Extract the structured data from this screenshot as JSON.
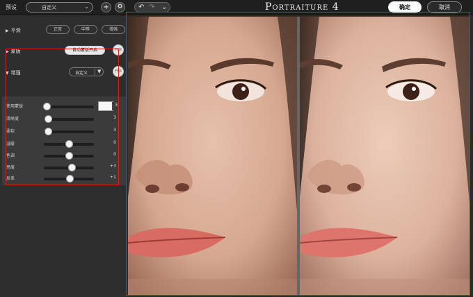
{
  "toolbar": {
    "preset_label": "预设",
    "preset_value": "自定义",
    "preset_chevron": "⌄",
    "add_icon": "+",
    "gear_icon": "⚙",
    "undo_icon": "↶",
    "redo_icon": "↷",
    "history_chevron": "⌄",
    "app_title": "Portraiture 4",
    "ok_label": "确定",
    "cancel_label": "取消"
  },
  "panel": {
    "smooth": {
      "label": "平滑",
      "options": [
        "正常",
        "中等",
        "增强"
      ]
    },
    "mask": {
      "label": "蒙版",
      "auto_button": "自动蒙版开启",
      "toggle": "开启"
    },
    "enhance": {
      "label": "增强",
      "dropdown_value": "自定义",
      "dropdown_arrow": "▼",
      "toggle": "开启",
      "sliders": [
        {
          "label": "使用蒙版",
          "value": "3",
          "level": 0.05
        },
        {
          "label": "清晰度",
          "value": "3",
          "level": 0.08
        },
        {
          "label": "柔软",
          "value": "3",
          "level": 0.08
        },
        {
          "label": "温暖",
          "value": "0",
          "level": 0.5
        },
        {
          "label": "色调",
          "value": "0",
          "level": 0.5
        },
        {
          "label": "亮度",
          "value": "+3",
          "level": 0.56
        },
        {
          "label": "反差",
          "value": "+1",
          "level": 0.52
        }
      ]
    }
  },
  "colors": {
    "highlight_box": "#c62828",
    "swatch": "#f7f7f7",
    "lips": "#d86b62"
  }
}
